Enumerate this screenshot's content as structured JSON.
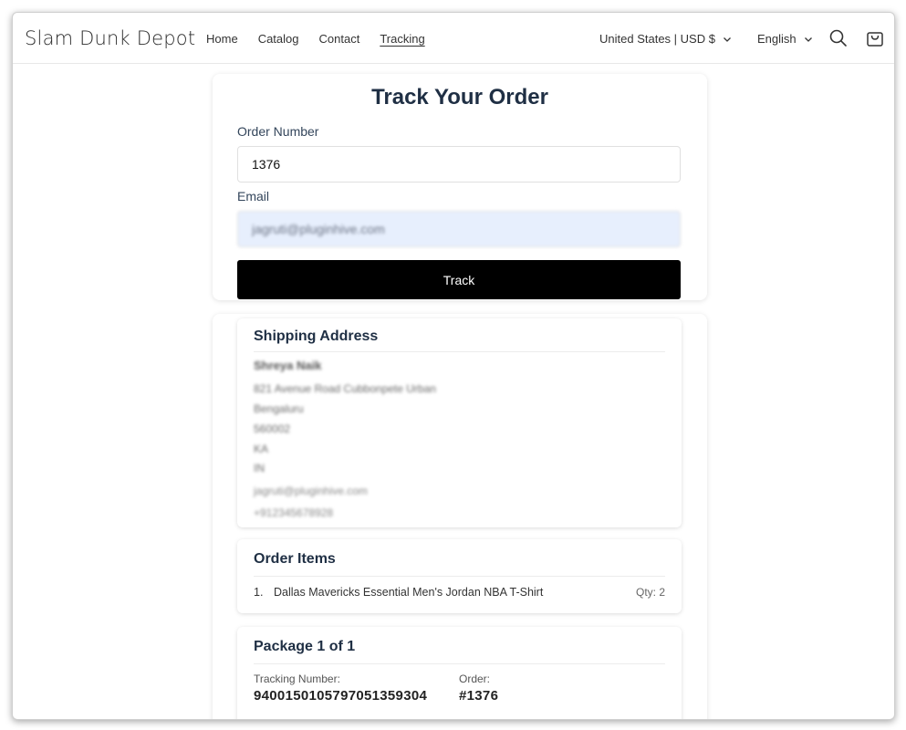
{
  "header": {
    "brand": "Slam Dunk Depot",
    "nav": [
      "Home",
      "Catalog",
      "Contact",
      "Tracking"
    ],
    "active_nav": "Tracking",
    "currency": "United States | USD $",
    "language": "English"
  },
  "form": {
    "title": "Track Your Order",
    "order_label": "Order Number",
    "order_value": "1376",
    "email_label": "Email",
    "email_value": "jagruti@pluginhive.com",
    "track_label": "Track"
  },
  "shipping": {
    "title": "Shipping Address",
    "name": "Shreya Naik",
    "lines": [
      "821 Avenue Road Cubbonpete Urban",
      "Bengaluru",
      "560002",
      "KA",
      "IN"
    ],
    "email": "jagruti@pluginhive.com",
    "phone": "+912345678928"
  },
  "order_items": {
    "title": "Order Items",
    "items": [
      {
        "index": "1.",
        "name": "Dallas Mavericks Essential Men's Jordan NBA T-Shirt",
        "qty": "Qty: 2"
      }
    ]
  },
  "package": {
    "title": "Package 1 of 1",
    "tracking_label": "Tracking Number:",
    "tracking_value": "9400150105797051359304",
    "order_label": "Order:",
    "order_value": "#1376"
  },
  "colors": {
    "heading": "#1f2f44",
    "button": "#000000",
    "email_bg": "#e7effd"
  }
}
